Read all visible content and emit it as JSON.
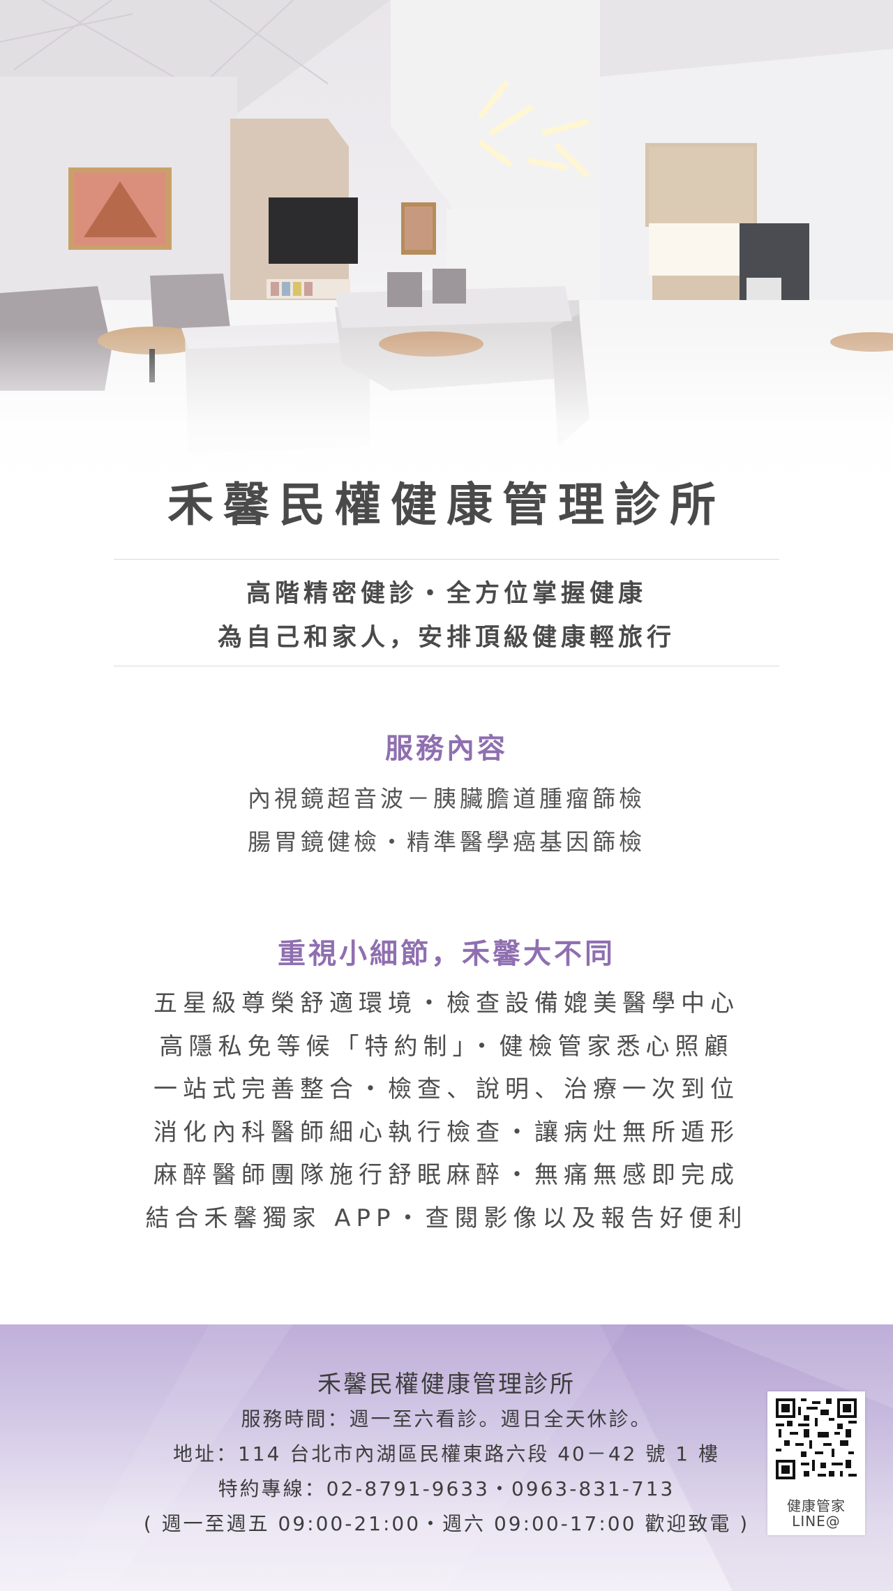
{
  "clinic_title": "禾馨民權健康管理診所",
  "tagline": [
    "高階精密健診・全方位掌握健康",
    "為自己和家人，安排頂級健康輕旅行"
  ],
  "services": {
    "heading": "服務內容",
    "lines": [
      "內視鏡超音波－胰臟膽道腫瘤篩檢",
      "腸胃鏡健檢・精準醫學癌基因篩檢"
    ]
  },
  "features": {
    "heading": "重視小細節，禾馨大不同",
    "lines": [
      "五星級尊榮舒適環境・檢查設備媲美醫學中心",
      "高隱私免等候「特約制」・健檢管家悉心照顧",
      "一站式完善整合・檢查、說明、治療一次到位",
      "消化內科醫師細心執行檢查・讓病灶無所遁形",
      "麻醉醫師團隊施行舒眠麻醉・無痛無感即完成",
      "結合禾馨獨家 APP・查閱影像以及報告好便利"
    ]
  },
  "footer": {
    "name": "禾馨民權健康管理診所",
    "hours": "服務時間：週一至六看診。週日全天休診。",
    "address": "地址：114 台北市內湖區民權東路六段 40－42 號 1 樓",
    "phone": "特約專線：02-8791-9633・0963-831-713",
    "phone_hours": "( 週一至週五 09:00-21:00・週六 09:00-17:00 歡迎致電 )",
    "qr_label_1": "健康管家",
    "qr_label_2": "LINE@"
  },
  "colors": {
    "accent": "#8f6fb0",
    "text": "#4a4a4a",
    "footer_top": "#b9a7d6",
    "footer_bottom": "#f3f0f8"
  }
}
